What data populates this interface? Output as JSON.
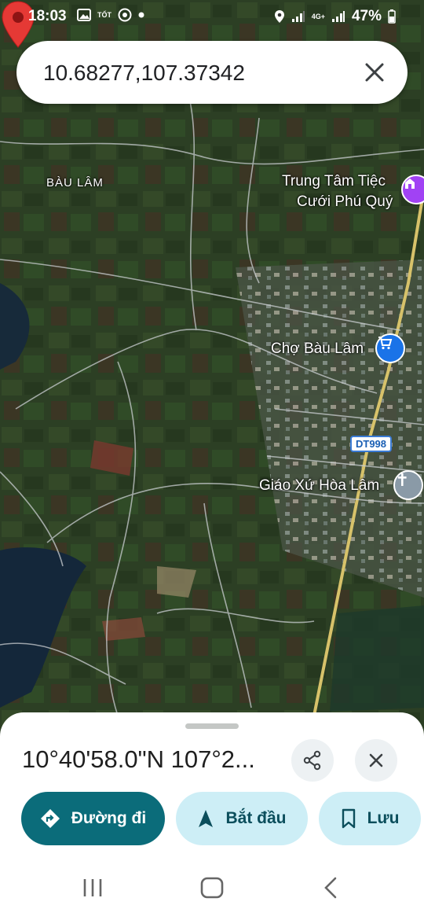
{
  "status_bar": {
    "time": "18:03",
    "carrier_tag": "TỐT",
    "network": "4G+",
    "battery": "47%"
  },
  "search": {
    "query": "10.68277,107.37342"
  },
  "map": {
    "labels": {
      "area": "BÀU LÂM",
      "poi_wedding_line1": "Trung Tâm Tiệc",
      "poi_wedding_line2": "Cưới Phú Quý",
      "poi_market": "Chợ Bàu Lâm",
      "poi_church": "Giáo Xứ Hòa Lâm",
      "road_shield": "DT998"
    },
    "poi_colors": {
      "wedding": "#a142f4",
      "market": "#1a73e8",
      "church": "#8a9aa7",
      "pin": "#e53935"
    }
  },
  "sheet": {
    "coordinates": "10°40'58.0\"N 107°2...",
    "buttons": {
      "directions": "Đường đi",
      "start": "Bắt đầu",
      "save": "Lưu"
    },
    "accent": "#0b6c7a"
  }
}
